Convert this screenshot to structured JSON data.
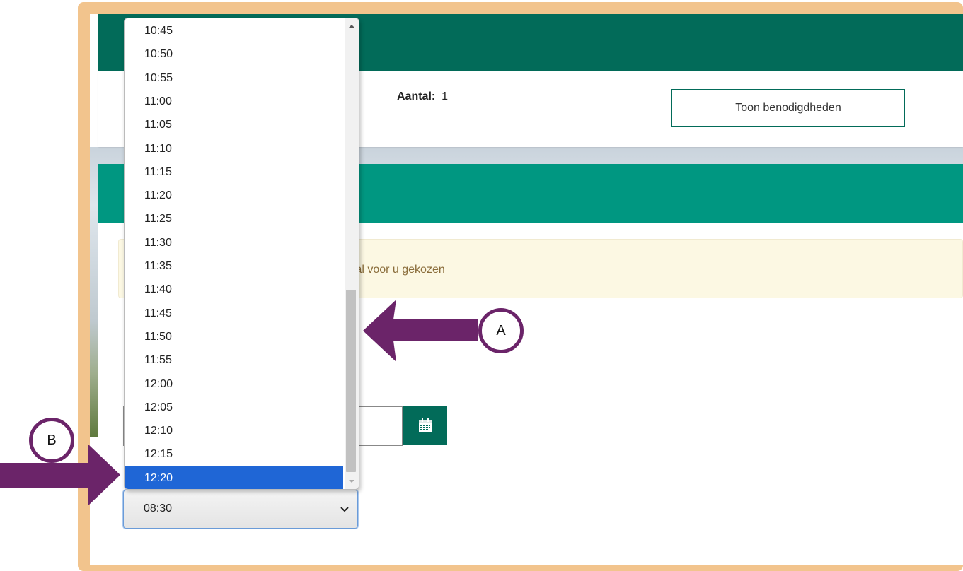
{
  "header": {
    "aantal_label": "Aantal:",
    "aantal_value": "1",
    "toon_button": "Toon benodigdheden"
  },
  "notice": {
    "text": "s al voor u gekozen"
  },
  "date_picker": {
    "value": "",
    "calendar_icon": "calendar-icon"
  },
  "time_select": {
    "selected_value": "08:30",
    "chevron_icon": "chevron-down-icon"
  },
  "dropdown": {
    "options": [
      "10:45",
      "10:50",
      "10:55",
      "11:00",
      "11:05",
      "11:10",
      "11:15",
      "11:20",
      "11:25",
      "11:30",
      "11:35",
      "11:40",
      "11:45",
      "11:50",
      "11:55",
      "12:00",
      "12:05",
      "12:10",
      "12:15",
      "12:20"
    ],
    "highlighted": "12:20"
  },
  "annotations": {
    "a_label": "A",
    "b_label": "B"
  },
  "colors": {
    "dark_green": "#026b59",
    "teal": "#009781",
    "frame": "#f2c48d",
    "arrow": "#6b2469",
    "highlight": "#1f66d6"
  }
}
